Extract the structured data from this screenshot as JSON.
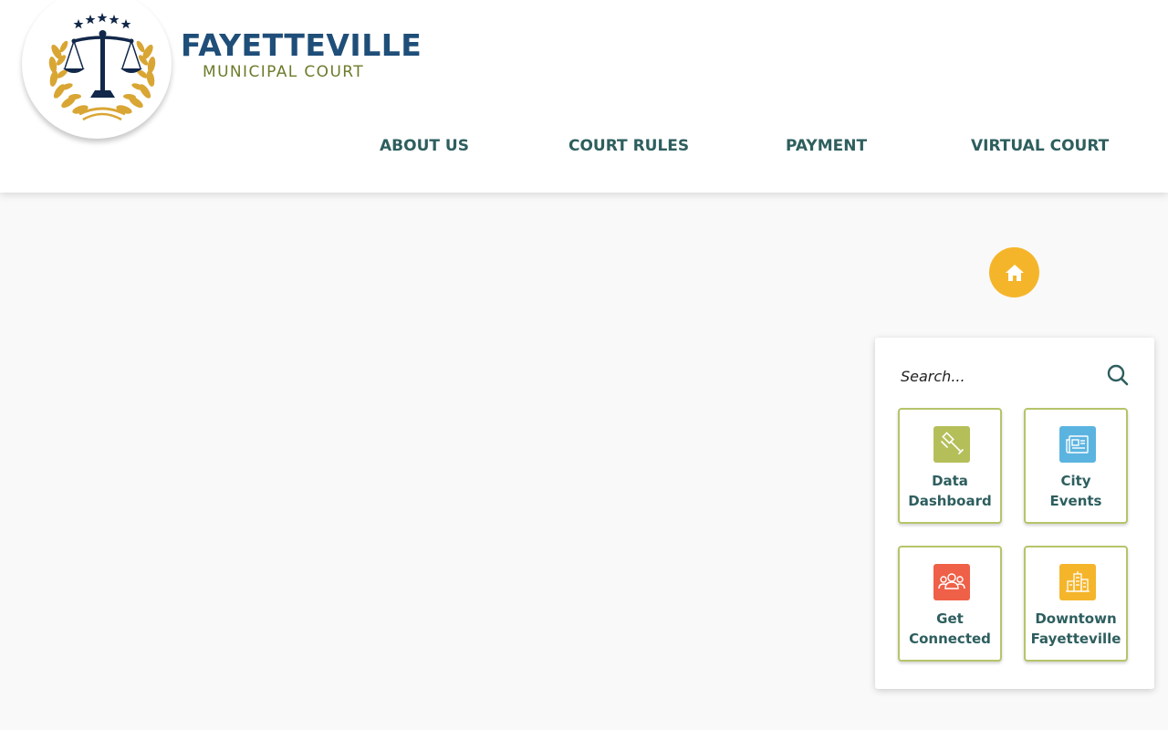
{
  "brand": {
    "title": "FAYETTEVILLE",
    "subtitle": "MUNICIPAL COURT",
    "logo_icon": "scales-of-justice-icon"
  },
  "nav": {
    "items": [
      {
        "label": "ABOUT US"
      },
      {
        "label": "COURT RULES"
      },
      {
        "label": "PAYMENT"
      },
      {
        "label": "VIRTUAL COURT"
      }
    ]
  },
  "home": {
    "icon": "home-icon",
    "color": "#f5b52b"
  },
  "search": {
    "placeholder": "Search...",
    "icon": "search-icon"
  },
  "tiles": [
    {
      "line1": "Data",
      "line2": "Dashboard",
      "icon": "gavel-icon",
      "color": "#b5bf5a"
    },
    {
      "line1": "City",
      "line2": "Events",
      "icon": "newspaper-icon",
      "color": "#5bb4e0"
    },
    {
      "line1": "Get",
      "line2": "Connected",
      "icon": "people-icon",
      "color": "#ef6048"
    },
    {
      "line1": "Downtown",
      "line2": "Fayetteville",
      "icon": "city-buildings-icon",
      "color": "#f5b52b"
    }
  ],
  "colors": {
    "brand_blue": "#1f4e79",
    "brand_olive": "#6b7c2b",
    "nav_text": "#2e5e5e",
    "tile_border": "#b6c46a"
  }
}
